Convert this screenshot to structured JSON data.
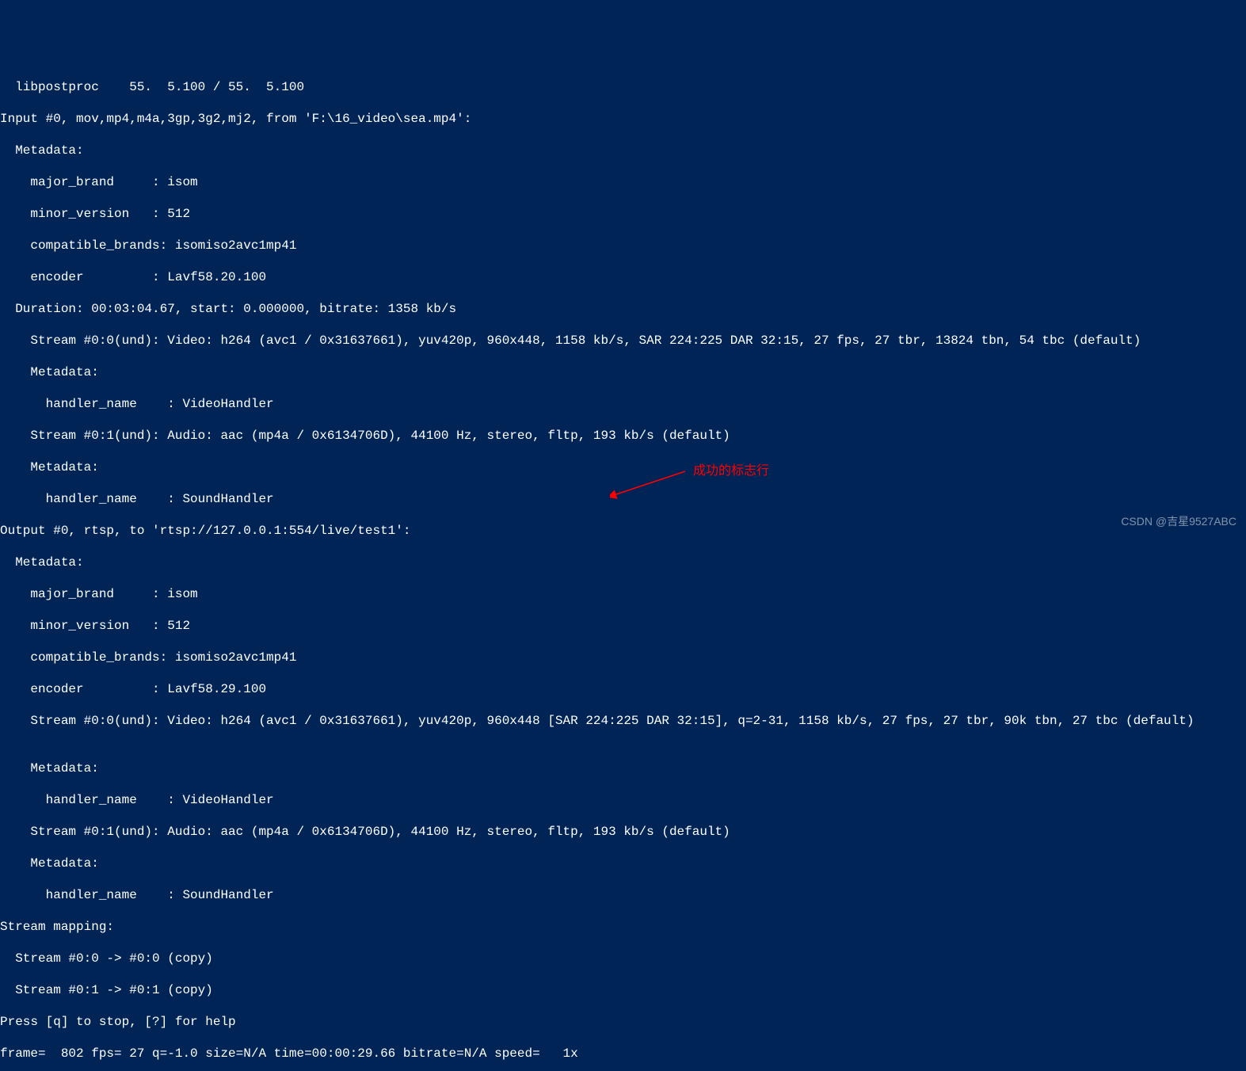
{
  "terminal": {
    "lines": [
      "  libpostproc    55.  5.100 / 55.  5.100",
      "Input #0, mov,mp4,m4a,3gp,3g2,mj2, from 'F:\\16_video\\sea.mp4':",
      "  Metadata:",
      "    major_brand     : isom",
      "    minor_version   : 512",
      "    compatible_brands: isomiso2avc1mp41",
      "    encoder         : Lavf58.20.100",
      "  Duration: 00:03:04.67, start: 0.000000, bitrate: 1358 kb/s",
      "    Stream #0:0(und): Video: h264 (avc1 / 0x31637661), yuv420p, 960x448, 1158 kb/s, SAR 224:225 DAR 32:15, 27 fps, 27 tbr, 13824 tbn, 54 tbc (default)",
      "    Metadata:",
      "      handler_name    : VideoHandler",
      "    Stream #0:1(und): Audio: aac (mp4a / 0x6134706D), 44100 Hz, stereo, fltp, 193 kb/s (default)",
      "    Metadata:",
      "      handler_name    : SoundHandler",
      "Output #0, rtsp, to 'rtsp://127.0.0.1:554/live/test1':",
      "  Metadata:",
      "    major_brand     : isom",
      "    minor_version   : 512",
      "    compatible_brands: isomiso2avc1mp41",
      "    encoder         : Lavf58.29.100",
      "    Stream #0:0(und): Video: h264 (avc1 / 0x31637661), yuv420p, 960x448 [SAR 224:225 DAR 32:15], q=2-31, 1158 kb/s, 27 fps, 27 tbr, 90k tbn, 27 tbc (default)",
      "",
      "    Metadata:",
      "      handler_name    : VideoHandler",
      "    Stream #0:1(und): Audio: aac (mp4a / 0x6134706D), 44100 Hz, stereo, fltp, 193 kb/s (default)",
      "    Metadata:",
      "      handler_name    : SoundHandler",
      "Stream mapping:",
      "  Stream #0:0 -> #0:0 (copy)",
      "  Stream #0:1 -> #0:1 (copy)",
      "Press [q] to stop, [?] for help",
      "frame=  802 fps= 27 q=-1.0 size=N/A time=00:00:29.66 bitrate=N/A speed=   1x"
    ]
  },
  "annotation": {
    "text": "成功的标志行"
  },
  "watermark": {
    "text": "CSDN @吉星9527ABC"
  }
}
